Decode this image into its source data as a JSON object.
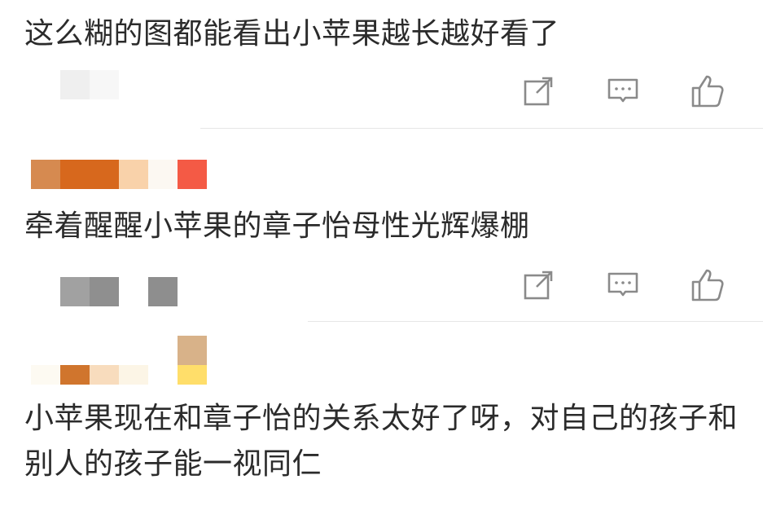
{
  "comments": [
    {
      "text": "这么糊的图都能看出小苹果越长越好看了",
      "author_pixels": [
        "#eeeeee",
        "#f7f7f7"
      ]
    },
    {
      "text": "牵着醒醒小苹果的章子怡母性光辉爆棚",
      "name_pixels": [
        "#d68a50",
        "#d7681d",
        "#d7681d",
        "#f9d2aa",
        "#fcf8f2",
        "#f45a45"
      ],
      "author_pixels": [
        "#a1a1a1",
        "#8f8f8f",
        "#ffffff",
        "#8e8e8e"
      ]
    },
    {
      "text": "小苹果现在和章子怡的关系太好了呀，对自己的孩子和别人的孩子能一视同仁",
      "name_pixels_top": [
        "#d8b289"
      ],
      "name_pixels": [
        "#fdfaf2",
        "#d0752d",
        "#f8dcbd",
        "#fcf5e6",
        "#ffffff",
        "#ffde6a"
      ]
    }
  ],
  "actions": {
    "share_icon": "share-icon",
    "reply_icon": "reply-icon",
    "like_icon": "like-icon"
  },
  "colors": {
    "text": "#2b2b2b",
    "icon": "#8a8a8a",
    "divider": "#e6e6e6"
  }
}
